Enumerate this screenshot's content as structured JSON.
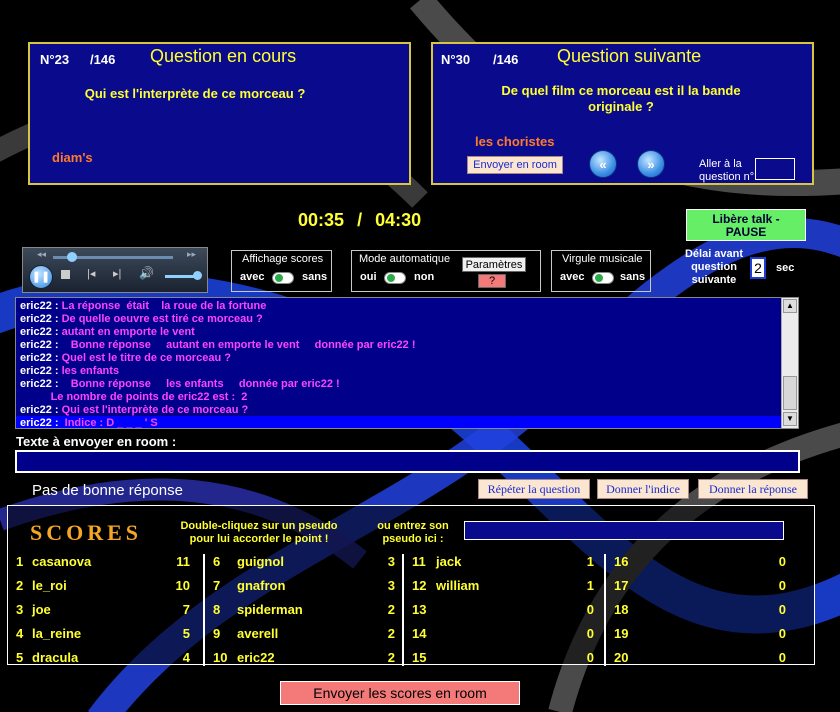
{
  "current_question": {
    "number": "N°23",
    "total": "/146",
    "title": "Question en cours",
    "text": "Qui est l'interprète de ce morceau ?",
    "answer": "diam's"
  },
  "next_question": {
    "number": "N°30",
    "total": "/146",
    "title": "Question suivante",
    "text_line1": "De quel film ce morceau est il la bande",
    "text_line2": "originale ?",
    "answer": "les choristes",
    "send_button": "Envoyer en room",
    "goto_label_line1": "Aller à la",
    "goto_label_line2": "question n°",
    "goto_value": ""
  },
  "timer": {
    "elapsed": "00:35",
    "separator": "/",
    "total": "04:30"
  },
  "talk_button_line1": "Libère talk -",
  "talk_button_line2": "PAUSE",
  "options": {
    "scores": {
      "title": "Affichage scores",
      "on": "avec",
      "off": "sans"
    },
    "auto": {
      "title": "Mode automatique",
      "on": "oui",
      "off": "non",
      "params_button": "Paramètres",
      "help_button": "?"
    },
    "jingle": {
      "title": "Virgule musicale",
      "on": "avec",
      "off": "sans"
    },
    "delay": {
      "line1": "Délai avant",
      "line2": "question",
      "line3": "suivante",
      "value": "2",
      "unit": "sec"
    }
  },
  "accent_colors": {
    "panel": "#0a0a8c",
    "text": "#ffff33",
    "answer": "#ff7b2a",
    "chat_msg": "#ff44ff",
    "talk_button": "#66ee66",
    "send_scores": "#f47a7a"
  },
  "chat": [
    {
      "user": "eric22 :",
      "msg": "La réponse  était    la roue de la fortune"
    },
    {
      "user": "eric22 :",
      "msg": "De quelle oeuvre est tiré ce morceau ?"
    },
    {
      "user": "eric22 :",
      "msg": "autant en emporte le vent"
    },
    {
      "user": "eric22 :",
      "msg": "   Bonne réponse     autant en emporte le vent     donnée par eric22 !"
    },
    {
      "user": "eric22 :",
      "msg": "Quel est le titre de ce morceau ?"
    },
    {
      "user": "eric22 :",
      "msg": "les enfants"
    },
    {
      "user": "eric22 :",
      "msg": "   Bonne réponse     les enfants     donnée par eric22 !"
    },
    {
      "user": "",
      "msg": "         Le nombre de points de eric22 est :  2"
    },
    {
      "user": "eric22 :",
      "msg": "Qui est l'interprète de ce morceau ?"
    },
    {
      "user": "eric22 :",
      "msg": " Indice : D _ _ _ ' S"
    }
  ],
  "send_label": "Texte à envoyer en room :",
  "send_value": "",
  "status": "Pas de bonne réponse",
  "action_buttons": {
    "repeat": "Répéter la question",
    "hint": "Donner l'indice",
    "answer": "Donner la réponse"
  },
  "scores_header": {
    "title": "SCORES",
    "hint_line1": "Double-cliquez sur un pseudo",
    "hint_line2": "pour lui accorder le point  !",
    "pseudo_line1": "ou entrez son",
    "pseudo_line2": "pseudo ici :",
    "pseudo_value": ""
  },
  "scores": [
    [
      {
        "rank": "1",
        "name": "casanova",
        "points": "11"
      },
      {
        "rank": "2",
        "name": "le_roi",
        "points": "10"
      },
      {
        "rank": "3",
        "name": "joe",
        "points": "7"
      },
      {
        "rank": "4",
        "name": "la_reine",
        "points": "5"
      },
      {
        "rank": "5",
        "name": "dracula",
        "points": "4"
      }
    ],
    [
      {
        "rank": "6",
        "name": "guignol",
        "points": "3"
      },
      {
        "rank": "7",
        "name": "gnafron",
        "points": "3"
      },
      {
        "rank": "8",
        "name": "spiderman",
        "points": "2"
      },
      {
        "rank": "9",
        "name": "averell",
        "points": "2"
      },
      {
        "rank": "10",
        "name": "eric22",
        "points": "2"
      }
    ],
    [
      {
        "rank": "11",
        "name": "jack",
        "points": "1"
      },
      {
        "rank": "12",
        "name": "william",
        "points": "1"
      },
      {
        "rank": "13",
        "name": "",
        "points": "0"
      },
      {
        "rank": "14",
        "name": "",
        "points": "0"
      },
      {
        "rank": "15",
        "name": "",
        "points": "0"
      }
    ],
    [
      {
        "rank": "16",
        "name": "",
        "points": "0"
      },
      {
        "rank": "17",
        "name": "",
        "points": "0"
      },
      {
        "rank": "18",
        "name": "",
        "points": "0"
      },
      {
        "rank": "19",
        "name": "",
        "points": "0"
      },
      {
        "rank": "20",
        "name": "",
        "points": "0"
      }
    ]
  ],
  "send_scores_button": "Envoyer les scores en room"
}
